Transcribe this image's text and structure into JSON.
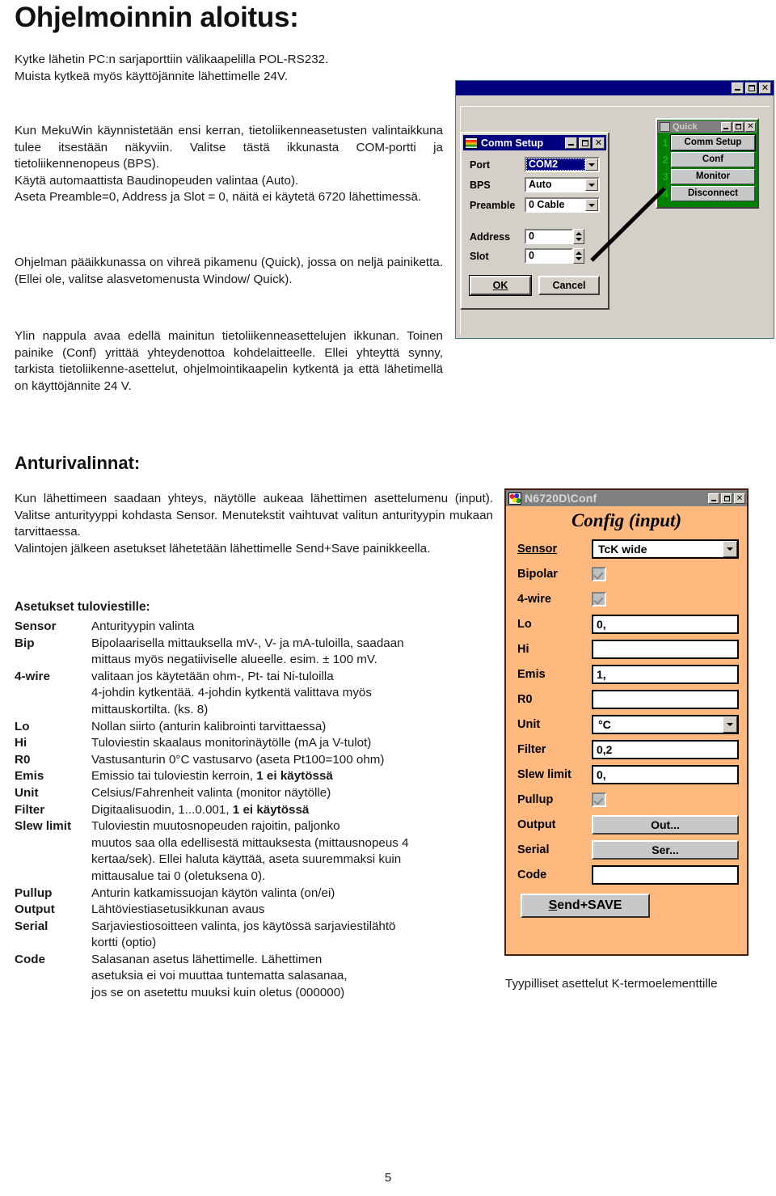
{
  "page": {
    "title": "Ohjelmoinnin aloitus:",
    "number": "5"
  },
  "intro": {
    "p1": "Kytke lähetin PC:n sarjaporttiin välikaapelilla POL-RS232.\nMuista kytkeä myös käyttöjännite lähettimelle 24V.",
    "p2": "Kun MekuWin käynnistetään ensi kerran, tietoliikenneasetusten valintaikkuna tulee itsestään näkyviin. Valitse tästä ikkunasta COM-portti ja tietoliikennenopeus (BPS).\nKäytä automaattista Baudinopeuden valintaa  (Auto).\nAseta Preamble=0, Address ja Slot = 0, näitä ei käytetä 6720 lähettimessä.",
    "p3": "Ohjelman pääikkunassa on vihreä pikamenu (Quick), jossa on neljä painiketta. (Ellei ole, valitse alasvetomenusta Window/ Quick).",
    "p4": "Ylin nappula avaa edellä mainitun tietoliikenneasettelujen ikkunan.  Toinen painike (Conf) yrittää yhteydenottoa kohdelaitteelle. Ellei yhteyttä synny, tarkista tietoliikenne-asettelut, ohjelmointikaapelin kytkentä ja että lähetimellä on käyttöjännite 24 V."
  },
  "comm_setup_window": {
    "title": "Comm Setup",
    "port_label": "Port",
    "port_value": "COM2",
    "bps_label": "BPS",
    "bps_value": "Auto",
    "preamble_label": "Preamble",
    "preamble_value": "0 Cable",
    "address_label": "Address",
    "address_value": "0",
    "slot_label": "Slot",
    "slot_value": "0",
    "ok_label": "OK",
    "cancel_label": "Cancel",
    "minimize_glyph": "_",
    "maximize_glyph": "□",
    "close_glyph": "✕"
  },
  "quick_window": {
    "title": "Quick",
    "buttons": [
      {
        "number": "1",
        "label": "Comm Setup"
      },
      {
        "number": "2",
        "label": "Conf"
      },
      {
        "number": "3",
        "label": "Monitor"
      },
      {
        "number": "4",
        "label": "Disconnect"
      }
    ]
  },
  "sensor_section": {
    "title": "Anturivalinnat:",
    "p1": "Kun lähettimeen saadaan  yhteys,  näytölle aukeaa lähettimen asettelumenu (input).  Valitse  anturityyppi kohdasta Sensor. Menutekstit vaihtuvat valitun anturityypin mukaan tarvittaessa.\nValintojen jälkeen asetukset  lähetetään lähettimelle Send+Save painikkeella.",
    "list_heading": "Asetukset tuloviestille:",
    "items": [
      {
        "term": "Sensor",
        "lines": [
          "Anturityypin valinta"
        ]
      },
      {
        "term": "Bip",
        "lines": [
          "Bipolaarisella mittauksella mV-, V- ja mA-tuloilla, saadaan",
          "mittaus myös negatiiviselle alueelle. esim. ± 100 mV."
        ]
      },
      {
        "term": "4-wire",
        "lines": [
          "valitaan jos käytetään ohm-, Pt- tai Ni-tuloilla",
          "4-johdin kytkentää. 4-johdin kytkentä valittava myös",
          "mittauskortilta. (ks. 8)"
        ]
      },
      {
        "term": "Lo",
        "lines": [
          "Nollan siirto (anturin kalibrointi tarvittaessa)"
        ]
      },
      {
        "term": "Hi",
        "lines": [
          "Tuloviestin skaalaus monitorinäytölle (mA ja V-tulot)"
        ]
      },
      {
        "term": "R0",
        "lines": [
          "Vastusanturin 0°C vastusarvo (aseta Pt100=100 ohm)"
        ]
      },
      {
        "term": "Emis",
        "lines": [
          "Emissio tai tuloviestin kerroin, <b>1 ei käytössä</b>"
        ]
      },
      {
        "term": "Unit",
        "lines": [
          "Celsius/Fahrenheit  valinta (monitor näytölle)"
        ]
      },
      {
        "term": "Filter",
        "lines": [
          "Digitaalisuodin, 1...0.001,   <b>1 ei käytössä</b>"
        ]
      },
      {
        "term": "Slew limit",
        "lines": [
          "Tuloviestin muutosnopeuden rajoitin, paljonko",
          "muutos saa olla edellisestä mittauksesta (mittausnopeus 4",
          "kertaa/sek). Ellei haluta käyttää, aseta suuremmaksi kuin",
          "mittausalue tai 0  (oletuksena 0)."
        ]
      },
      {
        "term": "Pullup",
        "lines": [
          "Anturin katkamissuojan käytön valinta (on/ei)"
        ]
      },
      {
        "term": "Output",
        "lines": [
          "Lähtöviestiasetusikkunan avaus"
        ]
      },
      {
        "term": "Serial",
        "lines": [
          "Sarjaviestiosoitteen valinta, jos käytössä sarjaviestilähtö",
          "kortti (optio)"
        ]
      },
      {
        "term": "Code",
        "lines": [
          "Salasanan asetus lähettimelle. Lähettimen",
          "asetuksia ei voi muuttaa tuntematta salasanaa,",
          "jos se on asetettu muuksi kuin oletus (000000)"
        ]
      }
    ]
  },
  "config_window": {
    "titlebar": "N6720D\\Conf",
    "heading": "Config (input)",
    "rows": [
      {
        "label": "Sensor",
        "type": "combo",
        "value": "TcK wide",
        "underline": true
      },
      {
        "label": "Bipolar",
        "type": "checkbox",
        "value": "checked"
      },
      {
        "label": "4-wire",
        "type": "checkbox",
        "value": "checked"
      },
      {
        "label": "Lo",
        "type": "field",
        "value": "0,"
      },
      {
        "label": "Hi",
        "type": "field",
        "value": ""
      },
      {
        "label": "Emis",
        "type": "field",
        "value": "1,"
      },
      {
        "label": "R0",
        "type": "field",
        "value": ""
      },
      {
        "label": "Unit",
        "type": "combo",
        "value": "°C"
      },
      {
        "label": "Filter",
        "type": "field",
        "value": "0,2"
      },
      {
        "label": "Slew limit",
        "type": "field",
        "value": "0,"
      },
      {
        "label": "Pullup",
        "type": "checkbox",
        "value": "checked"
      },
      {
        "label": "Output",
        "type": "button",
        "value": "Out..."
      },
      {
        "label": "Serial",
        "type": "button",
        "value": "Ser..."
      },
      {
        "label": "Code",
        "type": "field",
        "value": ""
      }
    ],
    "send_label": "Send+SAVE"
  },
  "config_caption": "Tyypilliset asettelut K-termoelementtille"
}
